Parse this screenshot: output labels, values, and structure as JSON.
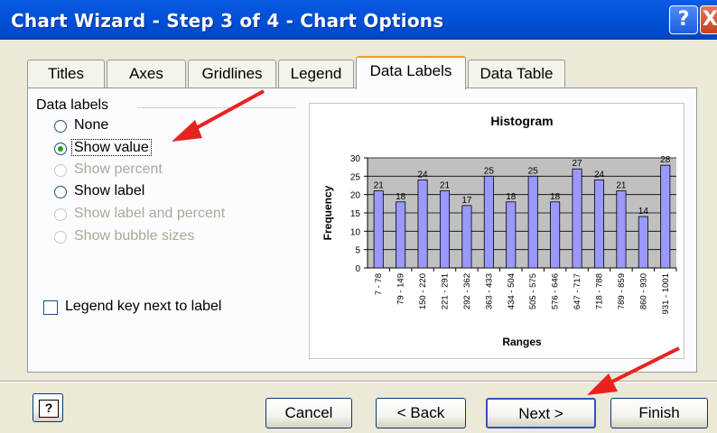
{
  "window": {
    "title": "Chart Wizard - Step 3 of 4 - Chart Options",
    "help_glyph": "?",
    "close_glyph": "X"
  },
  "tabs": [
    {
      "label": "Titles",
      "active": false
    },
    {
      "label": "Axes",
      "active": false
    },
    {
      "label": "Gridlines",
      "active": false
    },
    {
      "label": "Legend",
      "active": false
    },
    {
      "label": "Data Labels",
      "active": true
    },
    {
      "label": "Data Table",
      "active": false
    }
  ],
  "data_labels": {
    "group_title": "Data labels",
    "options": [
      {
        "label": "None",
        "checked": false,
        "enabled": true
      },
      {
        "label": "Show value",
        "checked": true,
        "enabled": true
      },
      {
        "label": "Show percent",
        "checked": false,
        "enabled": false
      },
      {
        "label": "Show label",
        "checked": false,
        "enabled": true
      },
      {
        "label": "Show label and percent",
        "checked": false,
        "enabled": false
      },
      {
        "label": "Show bubble sizes",
        "checked": false,
        "enabled": false
      }
    ],
    "legend_key_label": "Legend key next to label",
    "legend_key_checked": false
  },
  "chart_data": {
    "type": "bar",
    "title": "Histogram",
    "xlabel": "Ranges",
    "ylabel": "Frequency",
    "categories": [
      "7 - 78",
      "79 - 149",
      "150 - 220",
      "221 - 291",
      "292 - 362",
      "363 - 433",
      "434 - 504",
      "505 - 575",
      "576 - 646",
      "647 - 717",
      "718 - 788",
      "789 - 859",
      "860 - 930",
      "931 - 1001"
    ],
    "values": [
      21,
      18,
      24,
      21,
      17,
      25,
      18,
      25,
      18,
      27,
      24,
      21,
      14,
      28
    ],
    "ylim": [
      0,
      30
    ],
    "yticks": [
      0,
      5,
      10,
      15,
      20,
      25,
      30
    ],
    "bar_color": "#9999ff",
    "plot_bg": "#c0c0c0",
    "gridlines": true,
    "data_labels": true
  },
  "buttons": {
    "help": "?",
    "cancel": "Cancel",
    "back": "< Back",
    "next": "Next >",
    "finish": "Finish"
  },
  "colors": {
    "titlebar": "#0050d8",
    "annotation_arrow": "#e8231e",
    "tab_highlight": "#e6a02a"
  }
}
